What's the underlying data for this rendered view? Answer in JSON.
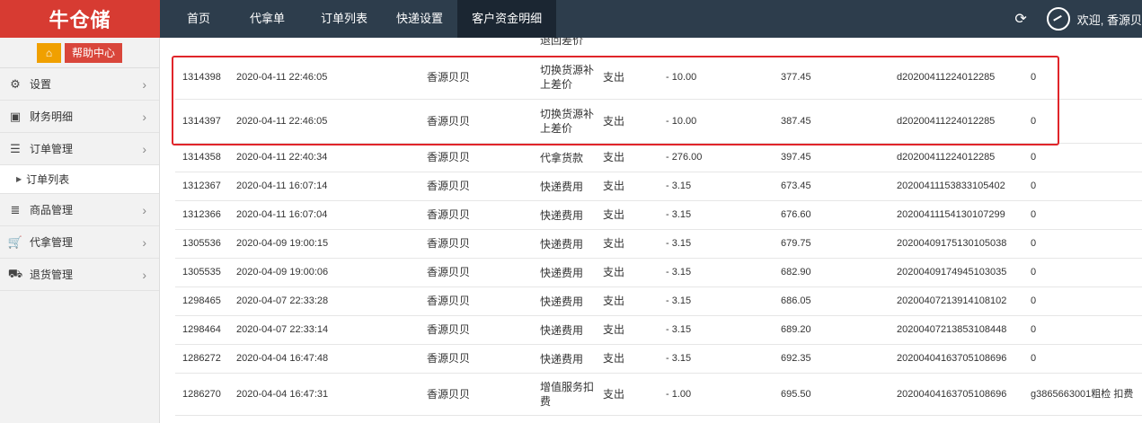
{
  "brand": {
    "logo_text": "牛仓储"
  },
  "topnav": {
    "items": [
      "首页",
      "代拿单",
      "订单列表",
      "快递设置",
      "客户资金明细"
    ],
    "active_index": 4,
    "welcome": "欢迎, 香源贝"
  },
  "sidebar": {
    "help_label": "帮助中心",
    "items": [
      {
        "label": "设置",
        "icon": "gear-icon"
      },
      {
        "label": "财务明细",
        "icon": "briefcase-icon"
      },
      {
        "label": "订单管理",
        "icon": "list-icon"
      },
      {
        "label": "商品管理",
        "icon": "list-alt-icon"
      },
      {
        "label": "代拿管理",
        "icon": "cart-icon"
      },
      {
        "label": "退货管理",
        "icon": "truck-icon"
      }
    ],
    "sub_item": "订单列表"
  },
  "partial_top_text": "退回差价",
  "rows": [
    {
      "id": "1314398",
      "time": "2020-04-11 22:46:05",
      "user": "香源贝贝",
      "type": "切换货源补上差价",
      "direction": "支出",
      "amount": "- 10.00",
      "balance": "377.45",
      "order": "d20200411224012285",
      "note": "0"
    },
    {
      "id": "1314397",
      "time": "2020-04-11 22:46:05",
      "user": "香源贝贝",
      "type": "切换货源补上差价",
      "direction": "支出",
      "amount": "- 10.00",
      "balance": "387.45",
      "order": "d20200411224012285",
      "note": "0"
    },
    {
      "id": "1314358",
      "time": "2020-04-11 22:40:34",
      "user": "香源贝贝",
      "type": "代拿货款",
      "direction": "支出",
      "amount": "- 276.00",
      "balance": "397.45",
      "order": "d20200411224012285",
      "note": "0"
    },
    {
      "id": "1312367",
      "time": "2020-04-11 16:07:14",
      "user": "香源贝贝",
      "type": "快递费用",
      "direction": "支出",
      "amount": "- 3.15",
      "balance": "673.45",
      "order": "20200411153833105402",
      "note": "0"
    },
    {
      "id": "1312366",
      "time": "2020-04-11 16:07:04",
      "user": "香源贝贝",
      "type": "快递费用",
      "direction": "支出",
      "amount": "- 3.15",
      "balance": "676.60",
      "order": "20200411154130107299",
      "note": "0"
    },
    {
      "id": "1305536",
      "time": "2020-04-09 19:00:15",
      "user": "香源贝贝",
      "type": "快递费用",
      "direction": "支出",
      "amount": "- 3.15",
      "balance": "679.75",
      "order": "20200409175130105038",
      "note": "0"
    },
    {
      "id": "1305535",
      "time": "2020-04-09 19:00:06",
      "user": "香源贝贝",
      "type": "快递费用",
      "direction": "支出",
      "amount": "- 3.15",
      "balance": "682.90",
      "order": "20200409174945103035",
      "note": "0"
    },
    {
      "id": "1298465",
      "time": "2020-04-07 22:33:28",
      "user": "香源贝贝",
      "type": "快递费用",
      "direction": "支出",
      "amount": "- 3.15",
      "balance": "686.05",
      "order": "20200407213914108102",
      "note": "0"
    },
    {
      "id": "1298464",
      "time": "2020-04-07 22:33:14",
      "user": "香源贝贝",
      "type": "快递费用",
      "direction": "支出",
      "amount": "- 3.15",
      "balance": "689.20",
      "order": "20200407213853108448",
      "note": "0"
    },
    {
      "id": "1286272",
      "time": "2020-04-04 16:47:48",
      "user": "香源贝贝",
      "type": "快递费用",
      "direction": "支出",
      "amount": "- 3.15",
      "balance": "692.35",
      "order": "20200404163705108696",
      "note": "0"
    },
    {
      "id": "1286270",
      "time": "2020-04-04 16:47:31",
      "user": "香源贝贝",
      "type": "增值服务扣费",
      "direction": "支出",
      "amount": "- 1.00",
      "balance": "695.50",
      "order": "20200404163705108696",
      "note": "g3865663001粗检 扣费"
    }
  ]
}
